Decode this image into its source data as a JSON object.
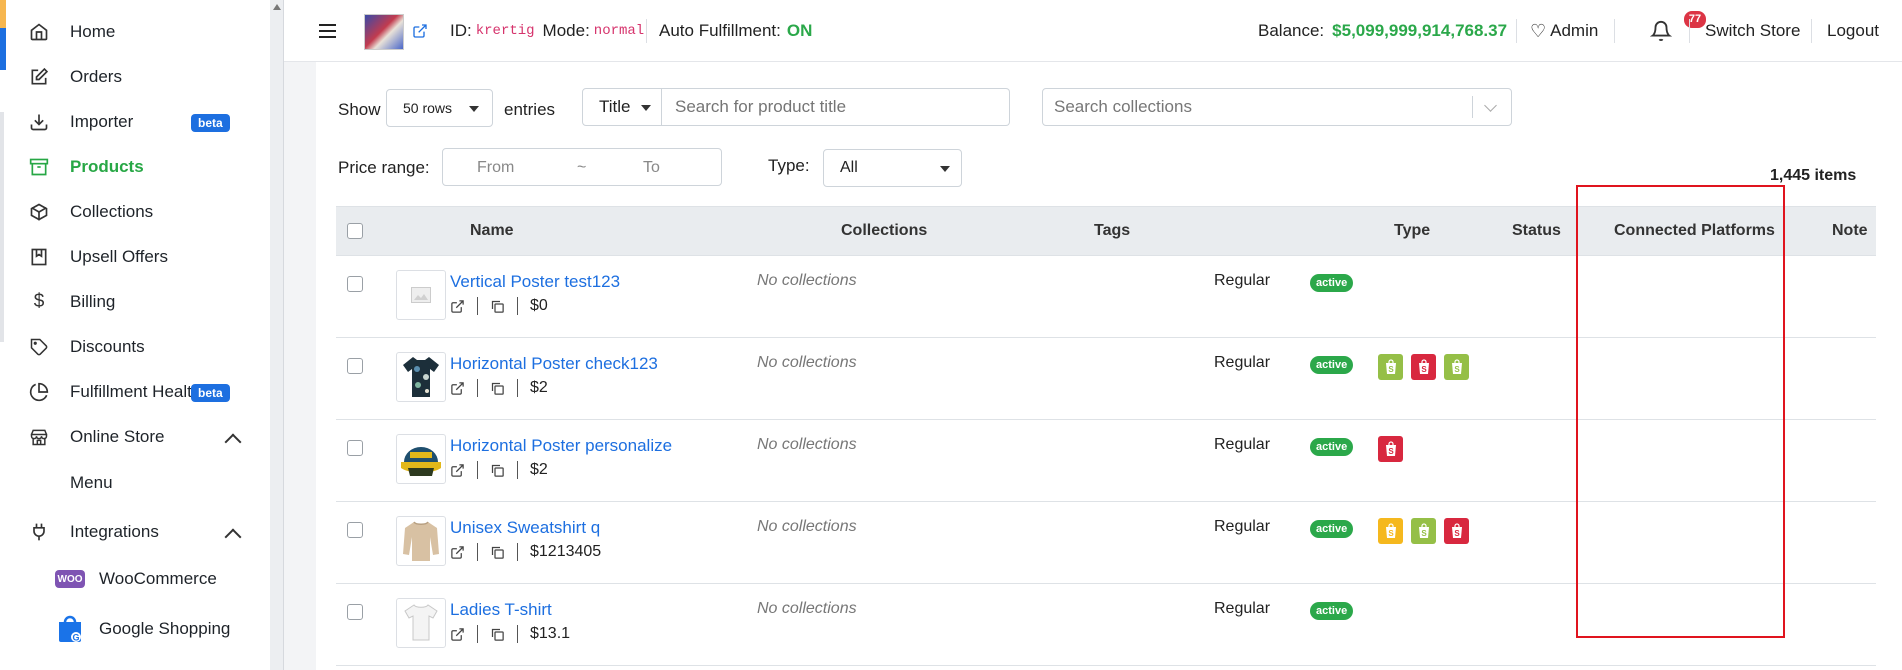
{
  "sidebar": {
    "items": [
      {
        "label": "Home",
        "icon": "home-icon"
      },
      {
        "label": "Orders",
        "icon": "edit-icon"
      },
      {
        "label": "Importer",
        "icon": "download-icon",
        "badge": "beta"
      },
      {
        "label": "Products",
        "icon": "archive-icon",
        "active": true
      },
      {
        "label": "Collections",
        "icon": "box-icon"
      },
      {
        "label": "Upsell Offers",
        "icon": "bookmark-icon"
      },
      {
        "label": "Billing",
        "icon": "dollar-icon"
      },
      {
        "label": "Discounts",
        "icon": "tag-icon"
      },
      {
        "label": "Fulfillment Health",
        "icon": "pie-chart-icon",
        "badge": "beta"
      },
      {
        "label": "Online Store",
        "icon": "store-icon"
      },
      {
        "label": "Menu"
      },
      {
        "label": "Integrations",
        "icon": "plug-icon"
      },
      {
        "label": "WooCommerce",
        "icon": "woocommerce-logo"
      },
      {
        "label": "Google Shopping",
        "icon": "google-shopping-logo"
      }
    ],
    "woo_text": "WOO"
  },
  "topbar": {
    "id_label": "ID:",
    "id_value": "krertig",
    "mode_label": "Mode:",
    "mode_value": "normal",
    "auto_label": "Auto Fulfillment:",
    "auto_value": "ON",
    "balance_label": "Balance:",
    "balance_value": "$5,099,999,914,768.37",
    "admin_label": "Admin",
    "notification_count": "77",
    "switch_store": "Switch Store",
    "logout": "Logout"
  },
  "filters": {
    "show_label": "Show",
    "rows_value": "50 rows",
    "entries_label": "entries",
    "search_field": "Title",
    "search_placeholder": "Search for product title",
    "collections_placeholder": "Search collections",
    "price_label": "Price range:",
    "price_from": "From",
    "price_sep": "~",
    "price_to": "To",
    "type_label": "Type:",
    "type_value": "All",
    "items_count": "1,445 items"
  },
  "table": {
    "headers": {
      "name": "Name",
      "collections": "Collections",
      "tags": "Tags",
      "type": "Type",
      "status": "Status",
      "platforms": "Connected Platforms",
      "note": "Note"
    },
    "rows": [
      {
        "name": "Vertical Poster test123",
        "price": "$0",
        "collections": "No collections",
        "type": "Regular",
        "status": "active",
        "platforms": []
      },
      {
        "name": "Horizontal Poster check123",
        "price": "$2",
        "collections": "No collections",
        "type": "Regular",
        "status": "active",
        "platforms": [
          "#95bf47",
          "#d8283f",
          "#95bf47"
        ]
      },
      {
        "name": "Horizontal Poster personalize",
        "price": "$2",
        "collections": "No collections",
        "type": "Regular",
        "status": "active",
        "platforms": [
          "#d8283f"
        ]
      },
      {
        "name": "Unisex Sweatshirt q",
        "price": "$1213405",
        "collections": "No collections",
        "type": "Regular",
        "status": "active",
        "platforms": [
          "#f5b81e",
          "#95bf47",
          "#d8283f"
        ]
      },
      {
        "name": "Ladies T-shirt",
        "price": "$13.1",
        "collections": "No collections",
        "type": "Regular",
        "status": "active",
        "platforms": []
      }
    ]
  },
  "colors": {
    "accent_green": "#2ba84a",
    "link_blue": "#1d6fe0",
    "highlight_red": "#e0141e"
  }
}
